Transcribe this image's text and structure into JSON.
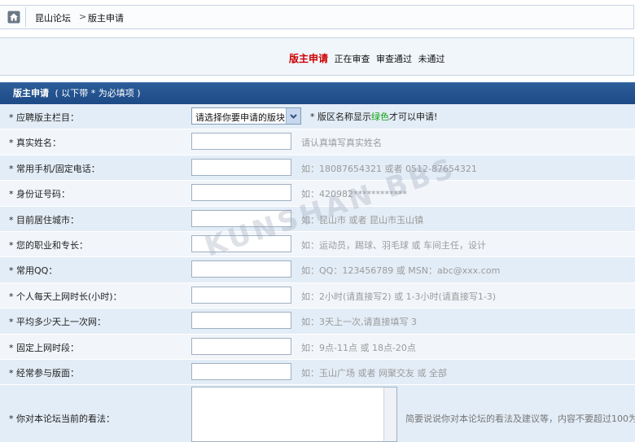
{
  "breadcrumb": {
    "home_icon": "home-icon",
    "item1": "昆山论坛",
    "separator": ">",
    "item2": "版主申请"
  },
  "status": {
    "title": "版主申请",
    "s1": "正在审查",
    "s2": "审查通过",
    "s3": "未通过"
  },
  "form": {
    "title": "版主申请",
    "note": "( 以下带 * 为必填项 )",
    "rows": [
      {
        "label": "* 应聘版主栏目：",
        "select_value": "请选择你要申请的版块",
        "hint_a": "* 版区名称显示",
        "hint_green": "绿色",
        "hint_b": "才可以申请!"
      },
      {
        "label": "* 真实姓名：",
        "hint": "请认真填写真实姓名"
      },
      {
        "label": "* 常用手机/固定电话：",
        "hint": "如：18087654321 或者 0512-87654321"
      },
      {
        "label": "* 身份证号码：",
        "hint": "如：420982************"
      },
      {
        "label": "* 目前居住城市：",
        "hint": "如：昆山市 或者 昆山市玉山镇"
      },
      {
        "label": "* 您的职业和专长：",
        "hint": "如：运动员，踢球、羽毛球 或 车间主任，设计"
      },
      {
        "label": "* 常用QQ：",
        "hint": "如：QQ：123456789 或 MSN：abc@xxx.com"
      },
      {
        "label": "* 个人每天上网时长(小时)：",
        "hint": "如：2小时(请直接写2) 或 1-3小时(请直接写1-3)"
      },
      {
        "label": "* 平均多少天上一次网：",
        "hint": "如：3天上一次,请直接填写 3"
      },
      {
        "label": "* 固定上网时段：",
        "hint": "如：9点-11点 或 18点-20点"
      },
      {
        "label": "* 经常参与版面：",
        "hint": "如：玉山广场 或者 网聚交友 或 全部"
      }
    ],
    "opinion": {
      "label": "* 你对本论坛当前的看法：",
      "hint": "简要说说你对本论坛的看法及建议等，内容不要超过100为"
    }
  },
  "watermark": "KUNSHAN BBS"
}
